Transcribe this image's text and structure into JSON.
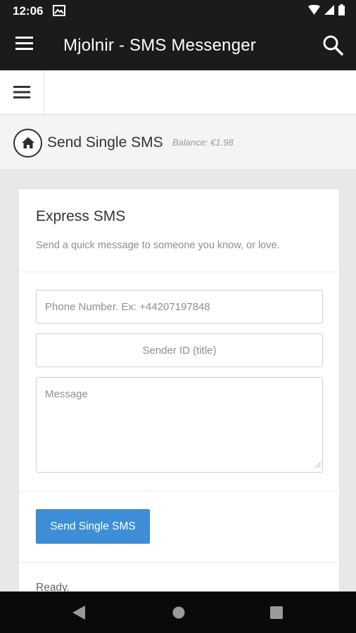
{
  "status_bar": {
    "time": "12:06"
  },
  "app_bar": {
    "title": "Mjolnir - SMS Messenger"
  },
  "breadcrumb": {
    "title": "Send Single SMS",
    "separator": "/",
    "balance": "Balance: €1.98"
  },
  "card": {
    "title": "Express SMS",
    "subtitle": "Send a quick message to someone you know, or love.",
    "phone_placeholder": "Phone Number. Ex: +44207197848",
    "sender_placeholder": "Sender ID (title)",
    "message_placeholder": "Message",
    "send_label": "Send Single SMS",
    "status": "Ready."
  }
}
